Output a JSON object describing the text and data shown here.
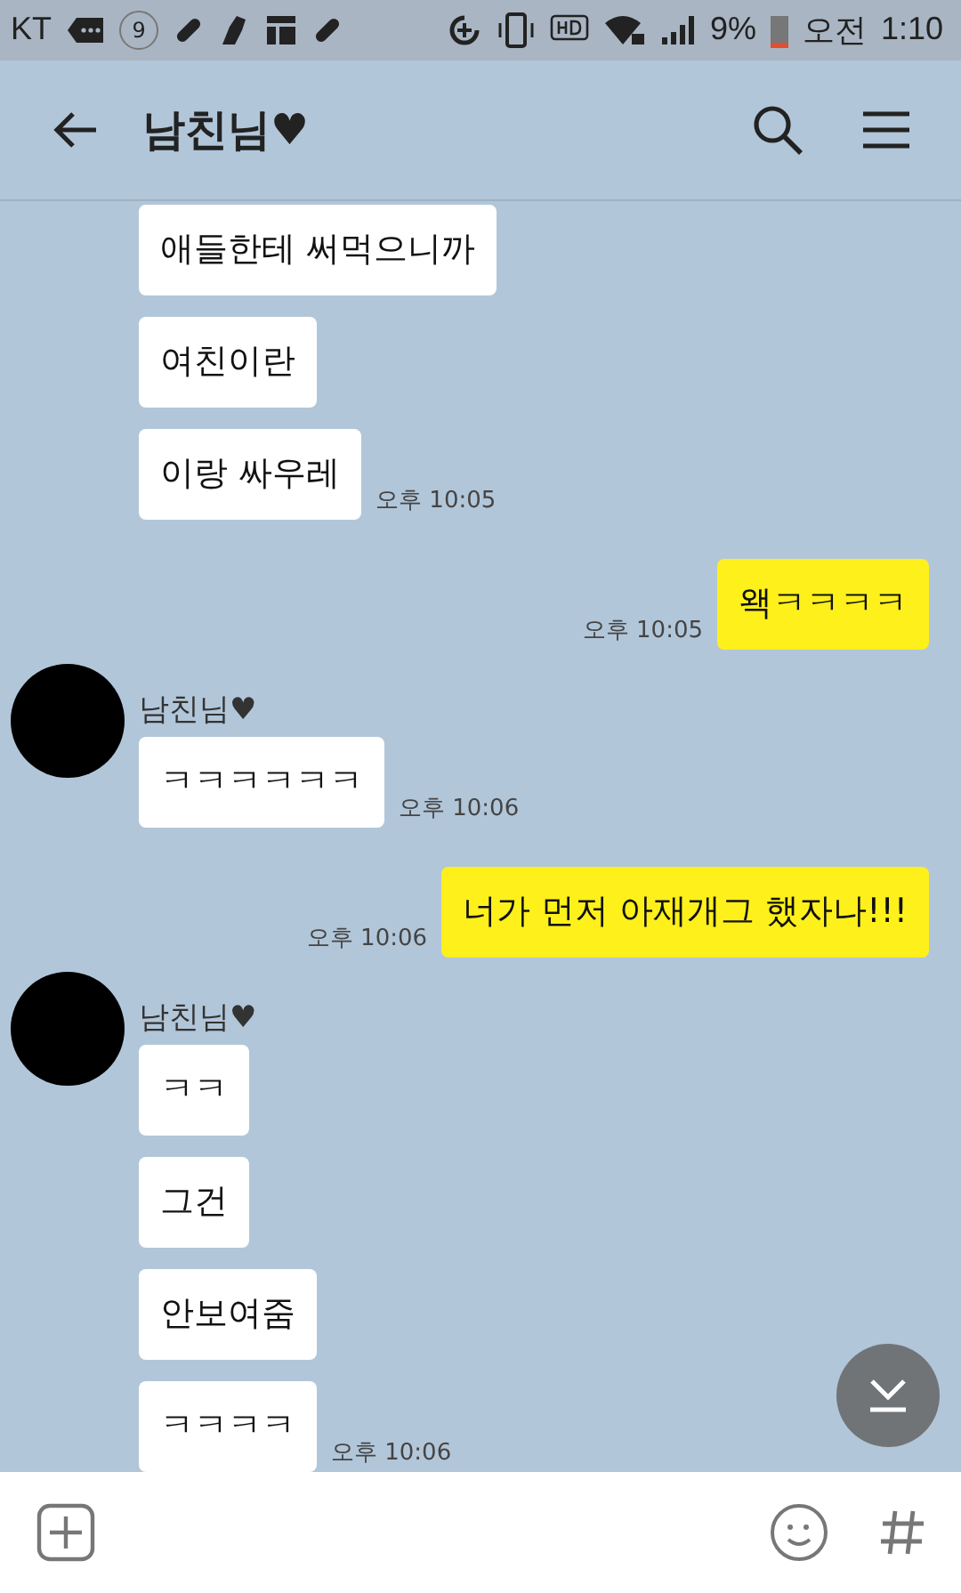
{
  "status_bar": {
    "carrier": "KT",
    "notification_count": "9",
    "battery": "9%",
    "ampm": "오전",
    "time": "1:10"
  },
  "header": {
    "title": "남친님♥"
  },
  "groups": [
    {
      "kind": "received",
      "messages": [
        {
          "text": "애들한테 써먹으니까"
        },
        {
          "text": "여친이란"
        },
        {
          "text": "이랑 싸우레",
          "time": "오후 10:05"
        }
      ]
    },
    {
      "kind": "sent",
      "messages": [
        {
          "text": "왝ㅋㅋㅋㅋ",
          "time": "오후 10:05"
        }
      ]
    },
    {
      "kind": "received",
      "sender": "남친님♥",
      "messages": [
        {
          "text": "ㅋㅋㅋㅋㅋㅋ",
          "time": "오후 10:06"
        }
      ]
    },
    {
      "kind": "sent",
      "messages": [
        {
          "text": "너가 먼저 아재개그 했자나!!!",
          "time": "오후 10:06"
        }
      ]
    },
    {
      "kind": "received",
      "sender": "남친님♥",
      "messages": [
        {
          "text": "ㅋㅋ"
        },
        {
          "text": "그건"
        },
        {
          "text": "안보여줌"
        },
        {
          "text": "ㅋㅋㅋㅋ",
          "time": "오후 10:06"
        }
      ]
    }
  ]
}
